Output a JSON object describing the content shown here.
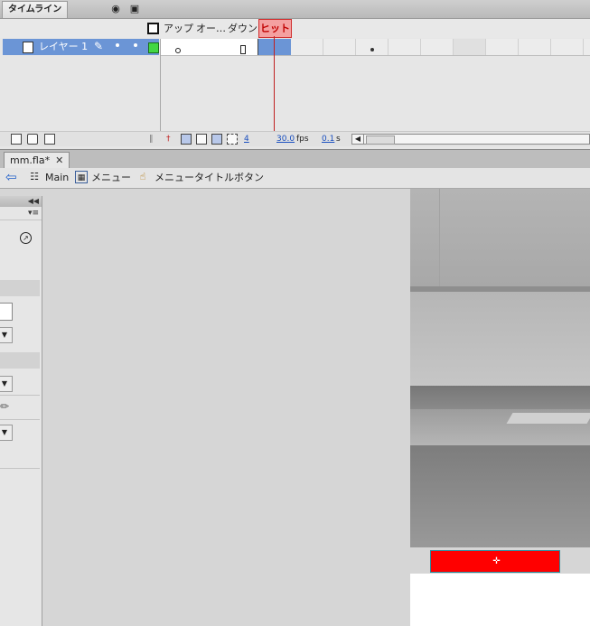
{
  "timeline": {
    "tab_label": "タイムライン",
    "frame_labels": [
      "アップ",
      "オー…",
      "ダウン",
      "ヒット"
    ],
    "layer": {
      "name": "レイヤー 1",
      "color": "#43d743"
    },
    "status": {
      "current_frame": "4",
      "fps_value": "30.0",
      "fps_unit": "fps",
      "time_value": "0.1",
      "time_unit": "s"
    }
  },
  "document": {
    "tab_label": "mm.fla*"
  },
  "breadcrumb": {
    "items": [
      {
        "label": "Main",
        "icon": "scene-clapper-icon"
      },
      {
        "label": "メニュー",
        "icon": "movieclip-symbol-icon"
      },
      {
        "label": "メニュータイトルボタン",
        "icon": "button-symbol-icon"
      }
    ]
  },
  "stage": {
    "hit_area_color": "#ff0000"
  }
}
